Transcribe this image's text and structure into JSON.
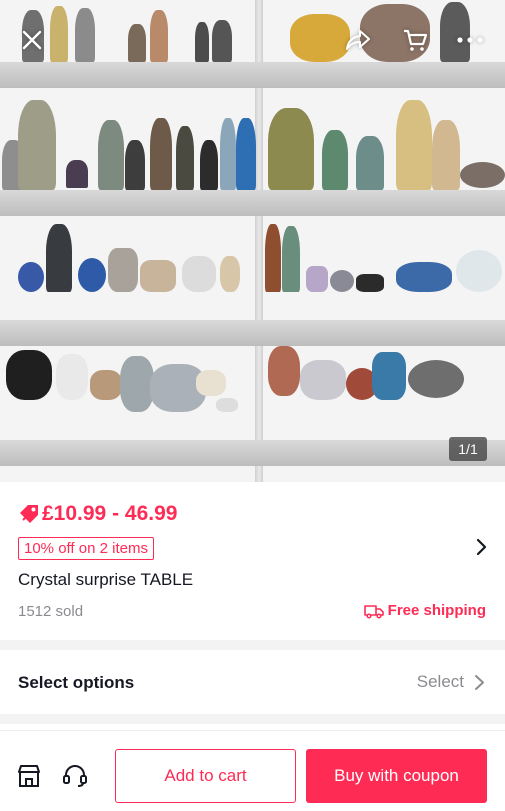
{
  "header": {
    "close_icon": "close-icon",
    "share_icon": "share-icon",
    "cart_icon": "cart-icon",
    "more_icon": "more-icon"
  },
  "gallery": {
    "counter": "1/1"
  },
  "product": {
    "price": "£10.99 - 46.99",
    "discount": "10% off on 2 items",
    "title": "Crystal surprise TABLE",
    "sold": "1512 sold",
    "shipping": "Free shipping"
  },
  "options": {
    "label": "Select options",
    "select": "Select"
  },
  "actions": {
    "add_to_cart": "Add to cart",
    "buy": "Buy with coupon"
  },
  "colors": {
    "accent": "#fe2c55",
    "muted": "#8a8b91",
    "text": "#161823"
  }
}
